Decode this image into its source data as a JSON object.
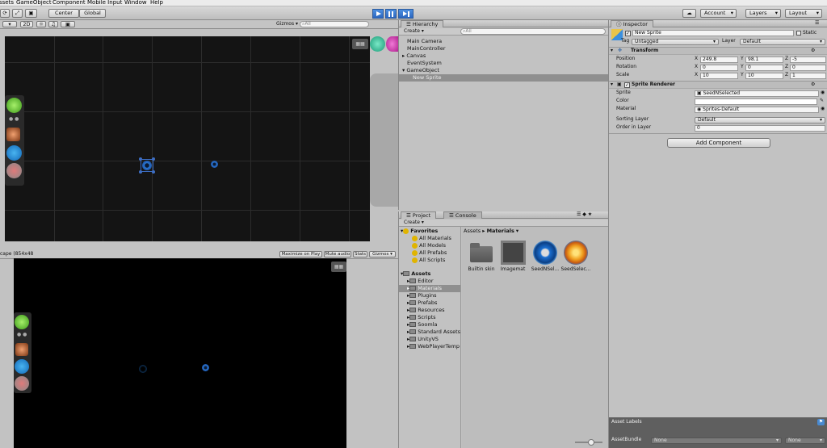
{
  "menu": [
    "ssets",
    "GameObject",
    "Component",
    "Mobile Input",
    "Window",
    "Help"
  ],
  "toolbar": {
    "pivot_center": "Center",
    "pivot_global": "Global",
    "account": "Account",
    "layers": "Layers",
    "layout": "Layout"
  },
  "scene": {
    "mode_2d": "2D",
    "gizmos": "Gizmos",
    "search_placeholder": "⌕All"
  },
  "game": {
    "aspect": "cape (854x48",
    "maximize": "Maximize on Play",
    "mute": "Mute audio",
    "stats": "Stats",
    "gizmos": "Gizmos"
  },
  "hierarchy": {
    "tab": "Hierarchy",
    "create": "Create",
    "search_placeholder": "⌕All",
    "items": [
      "Main Camera",
      "MainController",
      "Canvas",
      "EventSystem",
      "GameObject",
      "New Sprite"
    ]
  },
  "project": {
    "tab_project": "Project",
    "tab_console": "Console",
    "create": "Create",
    "breadcrumb_root": "Assets",
    "breadcrumb_current": "Materials",
    "favorites_label": "Favorites",
    "favorites": [
      "All Materials",
      "All Models",
      "All Prefabs",
      "All Scripts"
    ],
    "assets_label": "Assets",
    "folders": [
      "Editor",
      "Materials",
      "Plugins",
      "Prefabs",
      "Resources",
      "Scripts",
      "Soomla",
      "Standard Assets",
      "UnityVS",
      "WebPlayerTemp"
    ],
    "files": [
      "Builtin skin",
      "Imagemat",
      "SeedNSel...",
      "SeedSelec..."
    ]
  },
  "inspector": {
    "tab": "Inspector",
    "name": "New Sprite",
    "static": "Static",
    "tag_label": "Tag",
    "tag_value": "Untagged",
    "layer_label": "Layer",
    "layer_value": "Default",
    "transform": {
      "title": "Transform",
      "position_label": "Position",
      "rotation_label": "Rotation",
      "scale_label": "Scale",
      "position": {
        "x": "249.8",
        "y": "98.1",
        "z": "-5"
      },
      "rotation": {
        "x": "0",
        "y": "0",
        "z": "0"
      },
      "scale": {
        "x": "10",
        "y": "10",
        "z": "1"
      }
    },
    "sprite_renderer": {
      "title": "Sprite Renderer",
      "sprite_label": "Sprite",
      "sprite_value": "SeedNSelected",
      "color_label": "Color",
      "material_label": "Material",
      "material_value": "Sprites-Default",
      "sorting_layer_label": "Sorting Layer",
      "sorting_layer_value": "Default",
      "order_label": "Order in Layer",
      "order_value": "0"
    },
    "add_component": "Add Component",
    "asset_labels": "Asset Labels",
    "asset_bundle_label": "AssetBundle",
    "asset_bundle_value": "None",
    "asset_bundle_variant": "None"
  },
  "colors": {
    "selection": "#3d6ec4",
    "play_accent": "#2b67c0",
    "scene_bg": "#141414",
    "game_bg": "#000000"
  }
}
